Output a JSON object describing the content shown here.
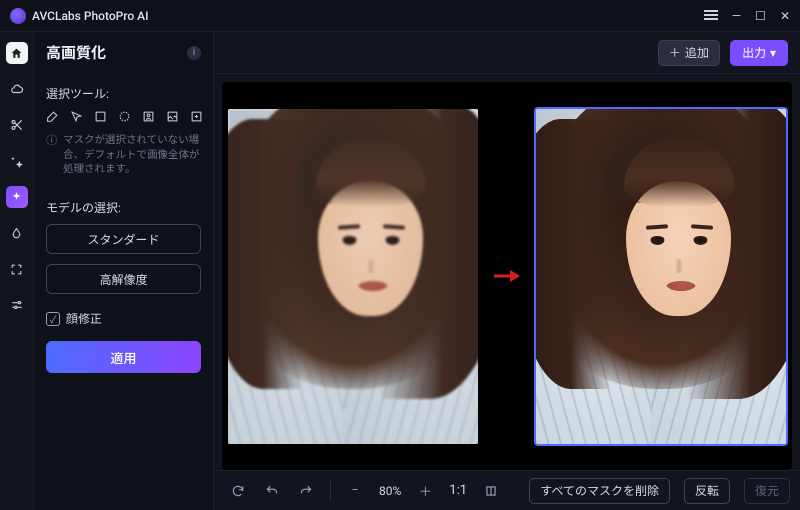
{
  "app": {
    "name": "AVCLabs PhotoPro AI"
  },
  "window": {
    "menu": "≡",
    "minimize": "—",
    "maximize": "☐",
    "close": "✕"
  },
  "header": {
    "title": "高画質化",
    "add_label": "追加",
    "output_label": "出力"
  },
  "side": {
    "tools_label": "選択ツール:",
    "hint": "マスクが選択されていない場合、デフォルトで画像全体が処理されます。",
    "model_label": "モデルの選択:",
    "model_options": {
      "standard": "スタンダード",
      "highres": "高解像度"
    },
    "face_fix_label": "顔修正",
    "apply_label": "適用"
  },
  "toolbar": {
    "zoom_value": "80%",
    "one_to_one": "1:1",
    "delete_masks_label": "すべてのマスクを削除",
    "invert_label": "反転",
    "restore_label": "復元"
  }
}
